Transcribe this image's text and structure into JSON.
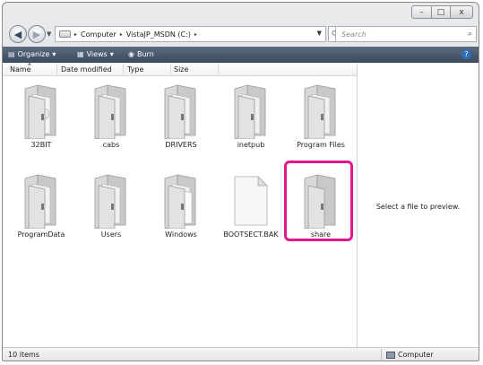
{
  "window": {
    "controls": {
      "minimize": "–",
      "maximize": "□",
      "close": "x"
    }
  },
  "address_bar": {
    "recent_caret": "▼",
    "crumbs": [
      "Computer",
      "VistaJP_MSDN (C:)"
    ],
    "sep": "▸",
    "search_placeholder": "Search"
  },
  "toolbar": {
    "organize": "Organize",
    "views": "Views",
    "burn": "Burn",
    "dropdown": "▾",
    "help": "?"
  },
  "columns": [
    "Name",
    "Date modified",
    "Type",
    "Size"
  ],
  "items": [
    {
      "label": "32BIT",
      "kind": "folder"
    },
    {
      "label": "cabs",
      "kind": "folder"
    },
    {
      "label": "DRIVERS",
      "kind": "folder"
    },
    {
      "label": "inetpub",
      "kind": "folder"
    },
    {
      "label": "Program Files",
      "kind": "folder"
    },
    {
      "label": "ProgramData",
      "kind": "folder"
    },
    {
      "label": "Users",
      "kind": "folder"
    },
    {
      "label": "Windows",
      "kind": "folder"
    },
    {
      "label": "BOOTSECT.BAK",
      "kind": "file"
    },
    {
      "label": "share",
      "kind": "folder",
      "highlighted": true
    }
  ],
  "preview": {
    "text": "Select a file to preview."
  },
  "status": {
    "count": "10 items",
    "location": "Computer"
  },
  "colors": {
    "highlight": "#e0198a",
    "toolbar": "#4a5a6e"
  }
}
